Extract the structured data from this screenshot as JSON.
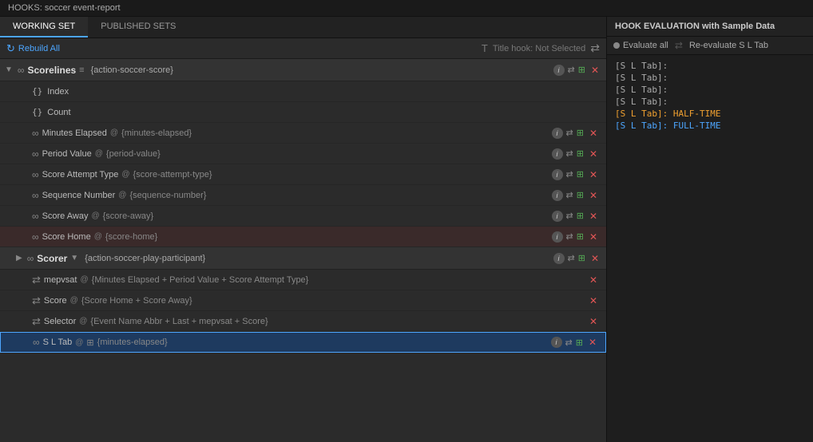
{
  "title_bar": {
    "text": "HOOKS: soccer event-report"
  },
  "tabs": {
    "working_set": "WORKING SET",
    "published_sets": "PUBLISHED SETS"
  },
  "toolbar": {
    "rebuild_label": "Rebuild All",
    "title_hook_label": "Title hook: Not Selected"
  },
  "right_panel": {
    "header": "HOOK EVALUATION with Sample Data",
    "evaluate_all": "Evaluate all",
    "reevaluate": "Re-evaluate S L Tab"
  },
  "section": {
    "name": "Scorelines",
    "tag": "{action-soccer-score}"
  },
  "rows": [
    {
      "type": "plain",
      "icon": "{}",
      "label": "Index",
      "at": "",
      "value": ""
    },
    {
      "type": "plain",
      "icon": "{}",
      "label": "Count",
      "at": "",
      "value": ""
    },
    {
      "type": "linked",
      "label": "Minutes Elapsed",
      "at": "@",
      "value": "{minutes-elapsed}"
    },
    {
      "type": "linked",
      "label": "Period Value",
      "at": "@",
      "value": "{period-value}"
    },
    {
      "type": "linked",
      "label": "Score Attempt Type",
      "at": "@",
      "value": "{score-attempt-type}"
    },
    {
      "type": "linked",
      "label": "Sequence Number",
      "at": "@",
      "value": "{sequence-number}"
    },
    {
      "type": "linked",
      "label": "Score Away",
      "at": "@",
      "value": "{score-away}"
    },
    {
      "type": "linked",
      "label": "Score Home",
      "at": "@",
      "value": "{score-home}"
    }
  ],
  "scorer_section": {
    "name": "Scorer",
    "filter_icon": "▼",
    "tag": "{action-soccer-play-participant}"
  },
  "compound_rows": [
    {
      "label": "mepvsat",
      "at": "@",
      "value": "{Minutes Elapsed + Period Value + Score Attempt Type}"
    },
    {
      "label": "Score",
      "at": "@",
      "value": "{Score Home + Score Away}"
    },
    {
      "label": "Selector",
      "at": "@",
      "value": "{Event Name Abbr + Last + mepvsat + Score}"
    }
  ],
  "selected_row": {
    "label": "S L Tab",
    "at": "@",
    "icon": "⊞",
    "value": "{minutes-elapsed}"
  },
  "eval_lines": [
    {
      "text": "[S L Tab]:",
      "type": "normal"
    },
    {
      "text": "[S L Tab]:",
      "type": "normal"
    },
    {
      "text": "[S L Tab]:",
      "type": "normal"
    },
    {
      "text": "[S L Tab]:",
      "type": "normal"
    },
    {
      "text": "[S L Tab]: HALF-TIME",
      "type": "halftime"
    },
    {
      "text": "[S L Tab]: FULL-TIME",
      "type": "fulltime"
    }
  ]
}
